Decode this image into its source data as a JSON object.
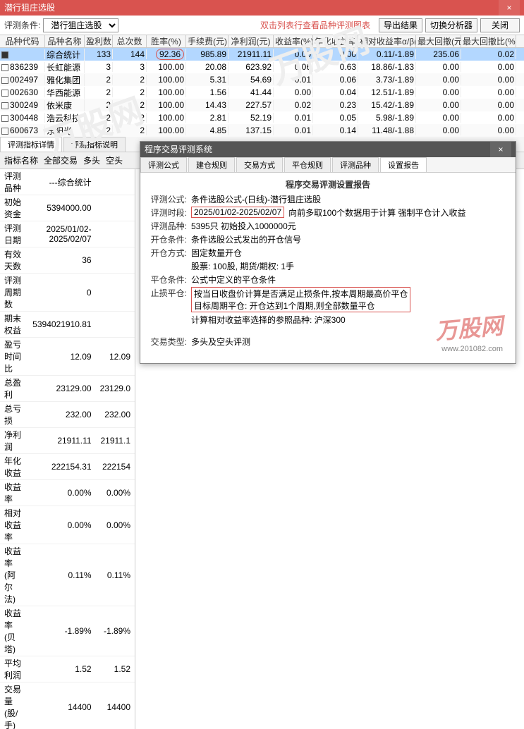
{
  "main_title": "潜行狙庄选股",
  "close_x": "×",
  "toolbar": {
    "criteria_label": "评测条件:",
    "criteria_value": "潜行狙庄选股",
    "hint": "双击列表行查看品种评测图表",
    "btn_export": "导出结果",
    "btn_switch": "切换分析器",
    "btn_close": "关闭"
  },
  "cols": [
    "品种代码",
    "品种名称",
    "盈利数",
    "总次数",
    "胜率(%)",
    "手续费(元)",
    "净利润(元)",
    "收益率(%)",
    "年化收益率(%)",
    "相对收益率α/β(%)",
    "最大回撤(元)",
    "最大回撤比(%)"
  ],
  "rows": [
    {
      "chk": true,
      "hl": true,
      "c": [
        "",
        "综合统计",
        "133",
        "144",
        "92.36",
        "985.89",
        "21911.11",
        "0.00",
        "0.00",
        "0.11/-1.89",
        "235.06",
        "0.02"
      ]
    },
    {
      "chk": false,
      "c": [
        "836239",
        "长虹能源",
        "3",
        "3",
        "100.00",
        "20.08",
        "623.92",
        "0.06",
        "0.63",
        "18.86/-1.83",
        "0.00",
        "0.00"
      ]
    },
    {
      "chk": false,
      "c": [
        "002497",
        "雅化集团",
        "2",
        "2",
        "100.00",
        "5.31",
        "54.69",
        "0.01",
        "0.06",
        "3.73/-1.89",
        "0.00",
        "0.00"
      ]
    },
    {
      "chk": false,
      "c": [
        "002630",
        "华西能源",
        "2",
        "2",
        "100.00",
        "1.56",
        "41.44",
        "0.00",
        "0.04",
        "12.51/-1.89",
        "0.00",
        "0.00"
      ]
    },
    {
      "chk": false,
      "c": [
        "300249",
        "依米康",
        "2",
        "2",
        "100.00",
        "14.43",
        "227.57",
        "0.02",
        "0.23",
        "15.42/-1.89",
        "0.00",
        "0.00"
      ]
    },
    {
      "chk": false,
      "c": [
        "300448",
        "浩云科技",
        "2",
        "2",
        "100.00",
        "2.81",
        "52.19",
        "0.01",
        "0.05",
        "5.98/-1.89",
        "0.00",
        "0.00"
      ]
    },
    {
      "chk": false,
      "c": [
        "600673",
        "东阳光",
        "2",
        "2",
        "100.00",
        "4.85",
        "137.15",
        "0.01",
        "0.14",
        "11.48/-1.88",
        "0.00",
        "0.00"
      ]
    }
  ],
  "tabs_lower": [
    "评测指标详情",
    "评测指标说明"
  ],
  "filter": {
    "name_label": "指标名称",
    "all": "全部交易",
    "long": "多头",
    "short": "空头"
  },
  "detail_rows": [
    [
      "评测品种",
      "---综合统计",
      ""
    ],
    [
      "初始资金",
      "5394000.00",
      ""
    ],
    [
      "评测日期",
      "2025/01/02-2025/02/07",
      ""
    ],
    [
      "有效天数",
      "36",
      ""
    ],
    [
      "评测周期数",
      "0",
      ""
    ],
    [
      "期末权益",
      "5394021910.81",
      ""
    ],
    [
      "盈亏时间比",
      "12.09",
      "12.09"
    ],
    [
      "总盈利",
      "23129.00",
      "23129.0"
    ],
    [
      "总亏损",
      "232.00",
      "232.00"
    ],
    [
      "净利润",
      "21911.11",
      "21911.1"
    ],
    [
      "年化收益",
      "222154.31",
      "222154"
    ],
    [
      "收益率",
      "0.00%",
      "0.00%"
    ],
    [
      "相对收益率",
      "0.00%",
      "0.00%"
    ],
    [
      "收益率(阿尔法)",
      "0.11%",
      "0.11%"
    ],
    [
      "收益率(贝塔)",
      "-1.89%",
      "-1.89%"
    ],
    [
      "平均利润",
      "1.52",
      "1.52"
    ],
    [
      "交易量(股/手)",
      "14400",
      "14400"
    ]
  ],
  "modal": {
    "title": "程序交易评测系统",
    "tabs": [
      "评测公式",
      "建仓规则",
      "交易方式",
      "平仓规则",
      "评测品种",
      "设置报告"
    ],
    "report_title": "程序交易评测设置报告",
    "rows": {
      "formula_lbl": "评测公式:",
      "formula_val": "条件选股公式-(日线)-潜行狙庄选股",
      "period_lbl": "评测时段:",
      "period_val": "2025/01/02-2025/02/07",
      "period_tail": "向前多取100个数据用于计算 强制平仓计入收益",
      "items_lbl": "评测品种:",
      "items_val": "5395只 初始投入1000000元",
      "open_lbl": "开仓条件:",
      "open_val": "条件选股公式发出的开仓信号",
      "method_lbl": "开仓方式:",
      "method_val": "固定数量开仓",
      "lot_val": "股票: 100股, 期货/期权: 1手",
      "close_lbl": "平仓条件:",
      "close_val": "公式中定义的平仓条件",
      "stop_lbl": "止损平仓:",
      "stop_val": "按当日收盘价计算是否满足止损条件,按本周期最高价平仓",
      "target_val": "目标周期平仓: 开仓达到1个周期,则全部数量平仓",
      "ref_val": "计算相对收益率选择的参照品种: 沪深300",
      "type_lbl": "交易类型:",
      "type_val": "多头及空头评测"
    }
  },
  "wm": "万股网",
  "wm_url": "www.201082.com"
}
